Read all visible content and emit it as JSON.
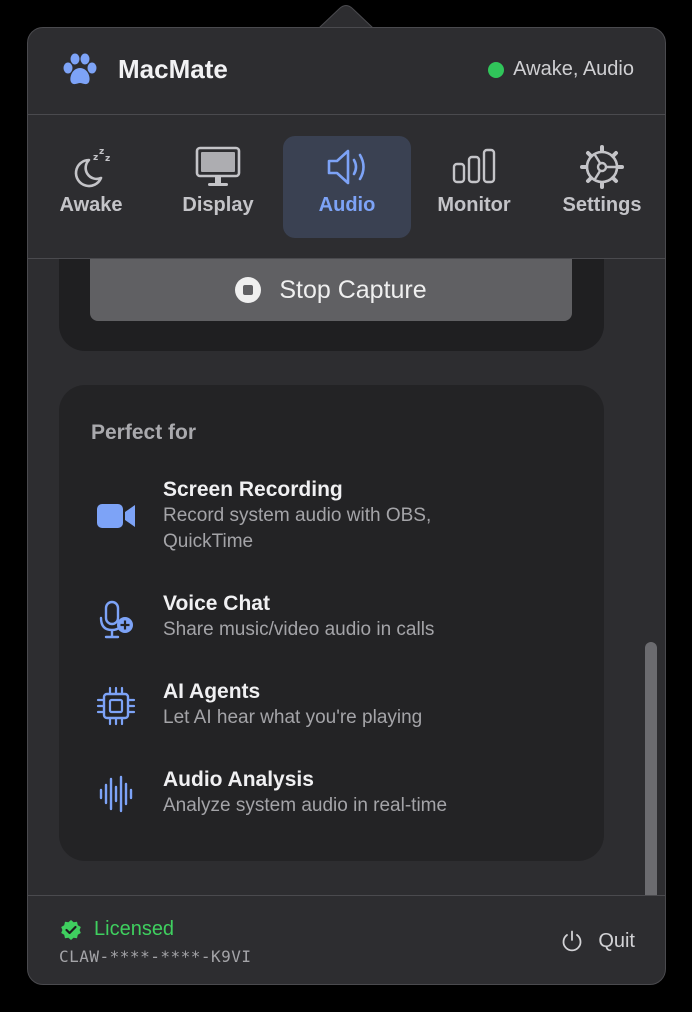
{
  "app": {
    "name": "MacMate",
    "icon": "paw-icon"
  },
  "status": {
    "text": "Awake, Audio",
    "color": "#30c55a"
  },
  "tabs": [
    {
      "label": "Awake",
      "icon": "moon-zzz-icon",
      "active": false
    },
    {
      "label": "Display",
      "icon": "monitor-icon",
      "active": false
    },
    {
      "label": "Audio",
      "icon": "speaker-icon",
      "active": true
    },
    {
      "label": "Monitor",
      "icon": "bar-chart-icon",
      "active": false
    },
    {
      "label": "Settings",
      "icon": "gear-icon",
      "active": false
    }
  ],
  "capture": {
    "stop_label": "Stop Capture",
    "icon": "stop-circle-icon"
  },
  "perfect_for": {
    "title": "Perfect for",
    "items": [
      {
        "title": "Screen Recording",
        "desc": "Record system audio with OBS, QuickTime",
        "icon": "video-camera-icon"
      },
      {
        "title": "Voice Chat",
        "desc": "Share music/video audio in calls",
        "icon": "microphone-plus-icon"
      },
      {
        "title": "AI Agents",
        "desc": "Let AI hear what you're playing",
        "icon": "cpu-chip-icon"
      },
      {
        "title": "Audio Analysis",
        "desc": "Analyze system audio in real-time",
        "icon": "waveform-icon"
      }
    ]
  },
  "footer": {
    "license_status": "Licensed",
    "license_key": "CLAW-****-****-K9VI",
    "quit_label": "Quit"
  },
  "colors": {
    "accent": "#7da3f7",
    "success": "#3fcf5f",
    "panel": "#2d2d30"
  }
}
